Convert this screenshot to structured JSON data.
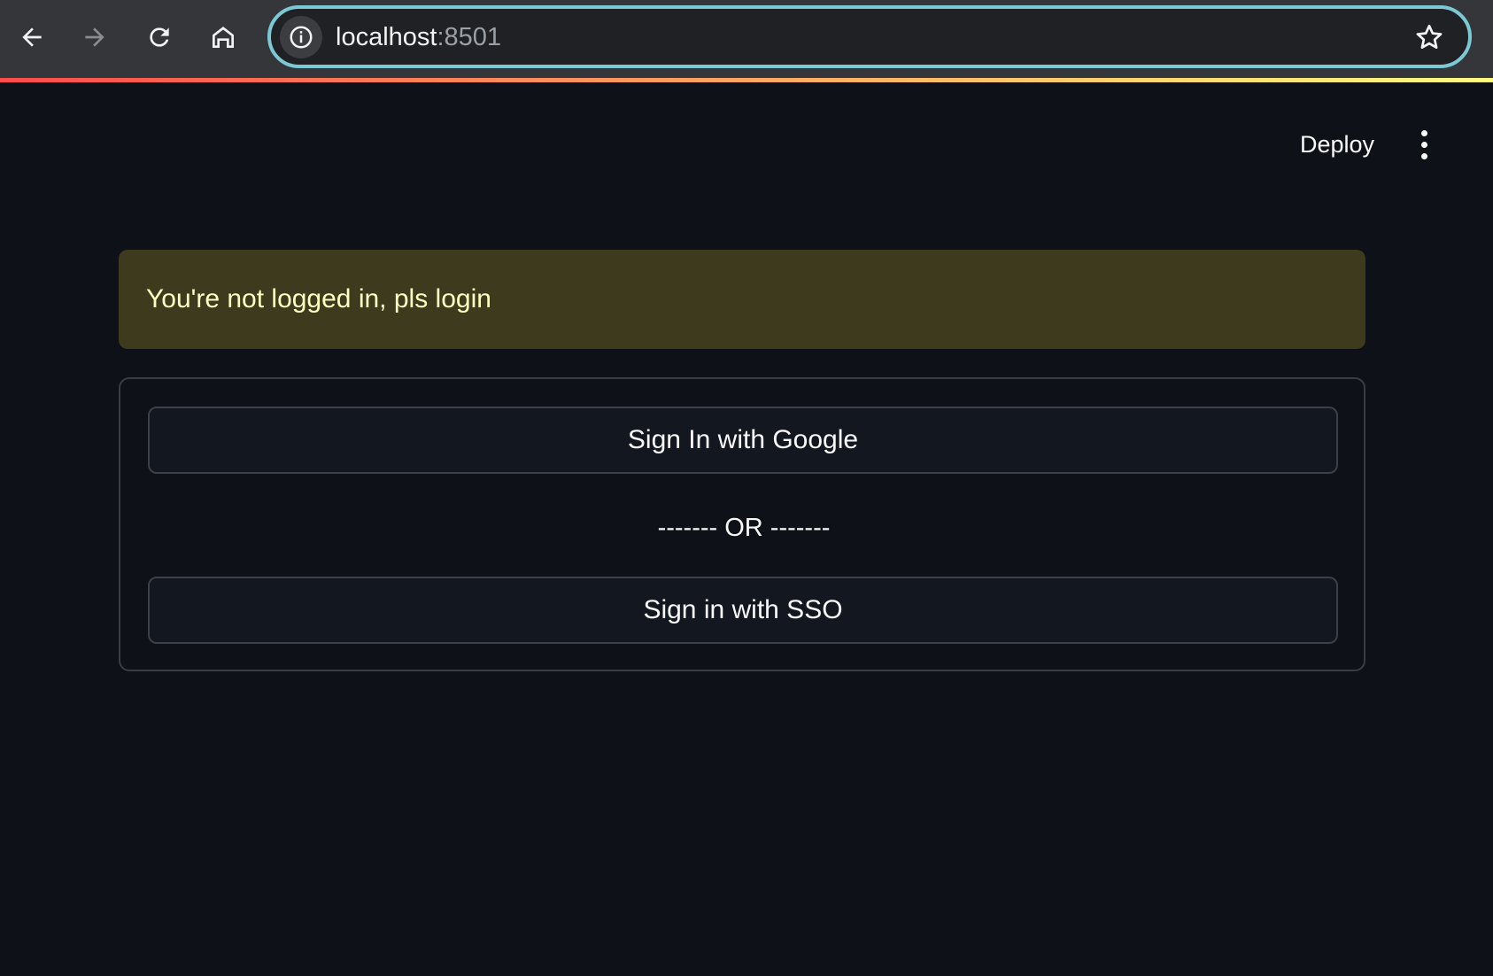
{
  "browser": {
    "url_host": "localhost",
    "url_port": ":8501",
    "icons": [
      "back-arrow-icon",
      "forward-arrow-icon",
      "reload-icon",
      "home-icon",
      "info-icon",
      "star-icon"
    ]
  },
  "header": {
    "deploy_label": "Deploy",
    "menu_icon": "vertical-dots-icon"
  },
  "alert": {
    "message": "You're not logged in, pls login",
    "background_color": "#3e3a1e",
    "text_color": "#ffffc2"
  },
  "login": {
    "google_button_label": "Sign In with Google",
    "divider_text": "------- OR -------",
    "sso_button_label": "Sign in with SSO"
  },
  "colors": {
    "page_background": "#0e1117",
    "accent_gradient": [
      "#ff4b4b",
      "#fffd80"
    ],
    "address_bar_focus": "#7cc9d6"
  }
}
